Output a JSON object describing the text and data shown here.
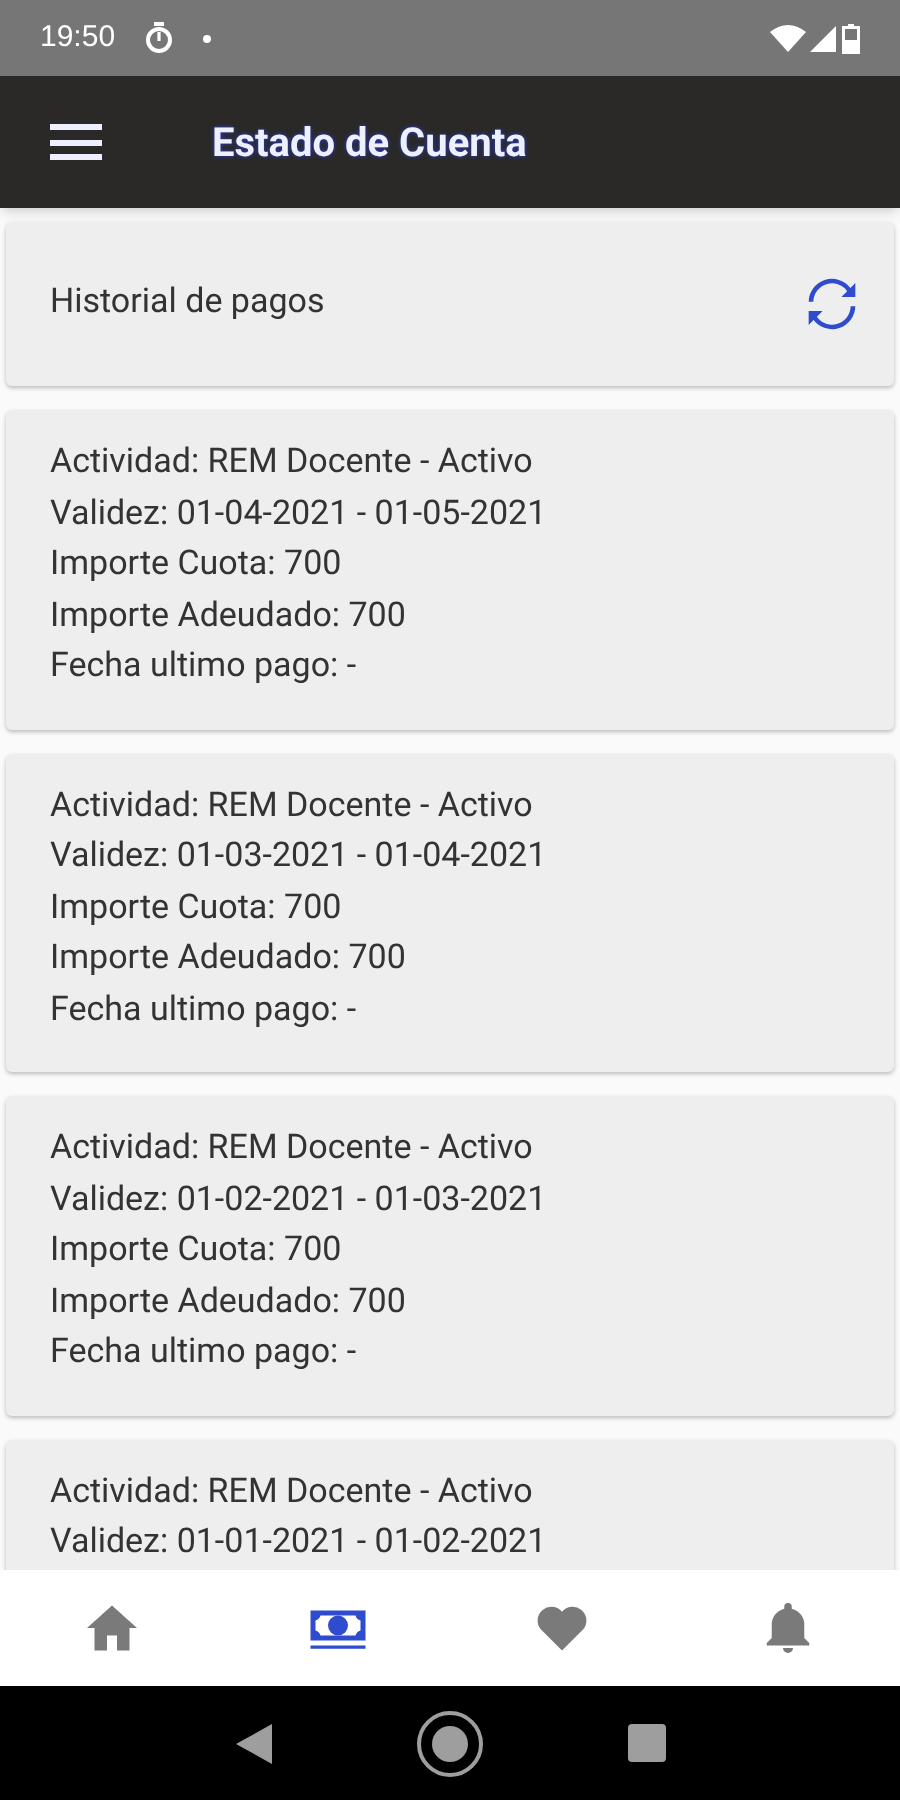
{
  "status_bar": {
    "time": "19:50"
  },
  "app_bar": {
    "title": "Estado de Cuenta"
  },
  "section": {
    "title": "Historial de pagos"
  },
  "payments": [
    {
      "lines": [
        "Actividad: REM Docente - Activo",
        "Validez: 01-04-2021 - 01-05-2021",
        "Importe Cuota: 700",
        "Importe Adeudado: 700",
        "Fecha ultimo pago: -"
      ]
    },
    {
      "lines": [
        "Actividad: REM Docente - Activo",
        "Validez: 01-03-2021 - 01-04-2021",
        "Importe Cuota: 700",
        "Importe Adeudado: 700",
        "Fecha ultimo pago: -"
      ]
    },
    {
      "lines": [
        "Actividad: REM Docente - Activo",
        "Validez: 01-02-2021 - 01-03-2021",
        "Importe Cuota: 700",
        "Importe Adeudado: 700",
        "Fecha ultimo pago: -"
      ]
    },
    {
      "lines": [
        "Actividad: REM Docente - Activo",
        "Validez: 01-01-2021 - 01-02-2021"
      ]
    }
  ],
  "bottom_nav": [
    {
      "kind": "home",
      "selected": false
    },
    {
      "kind": "money",
      "selected": true
    },
    {
      "kind": "heart",
      "selected": false
    },
    {
      "kind": "bell",
      "selected": false
    }
  ]
}
